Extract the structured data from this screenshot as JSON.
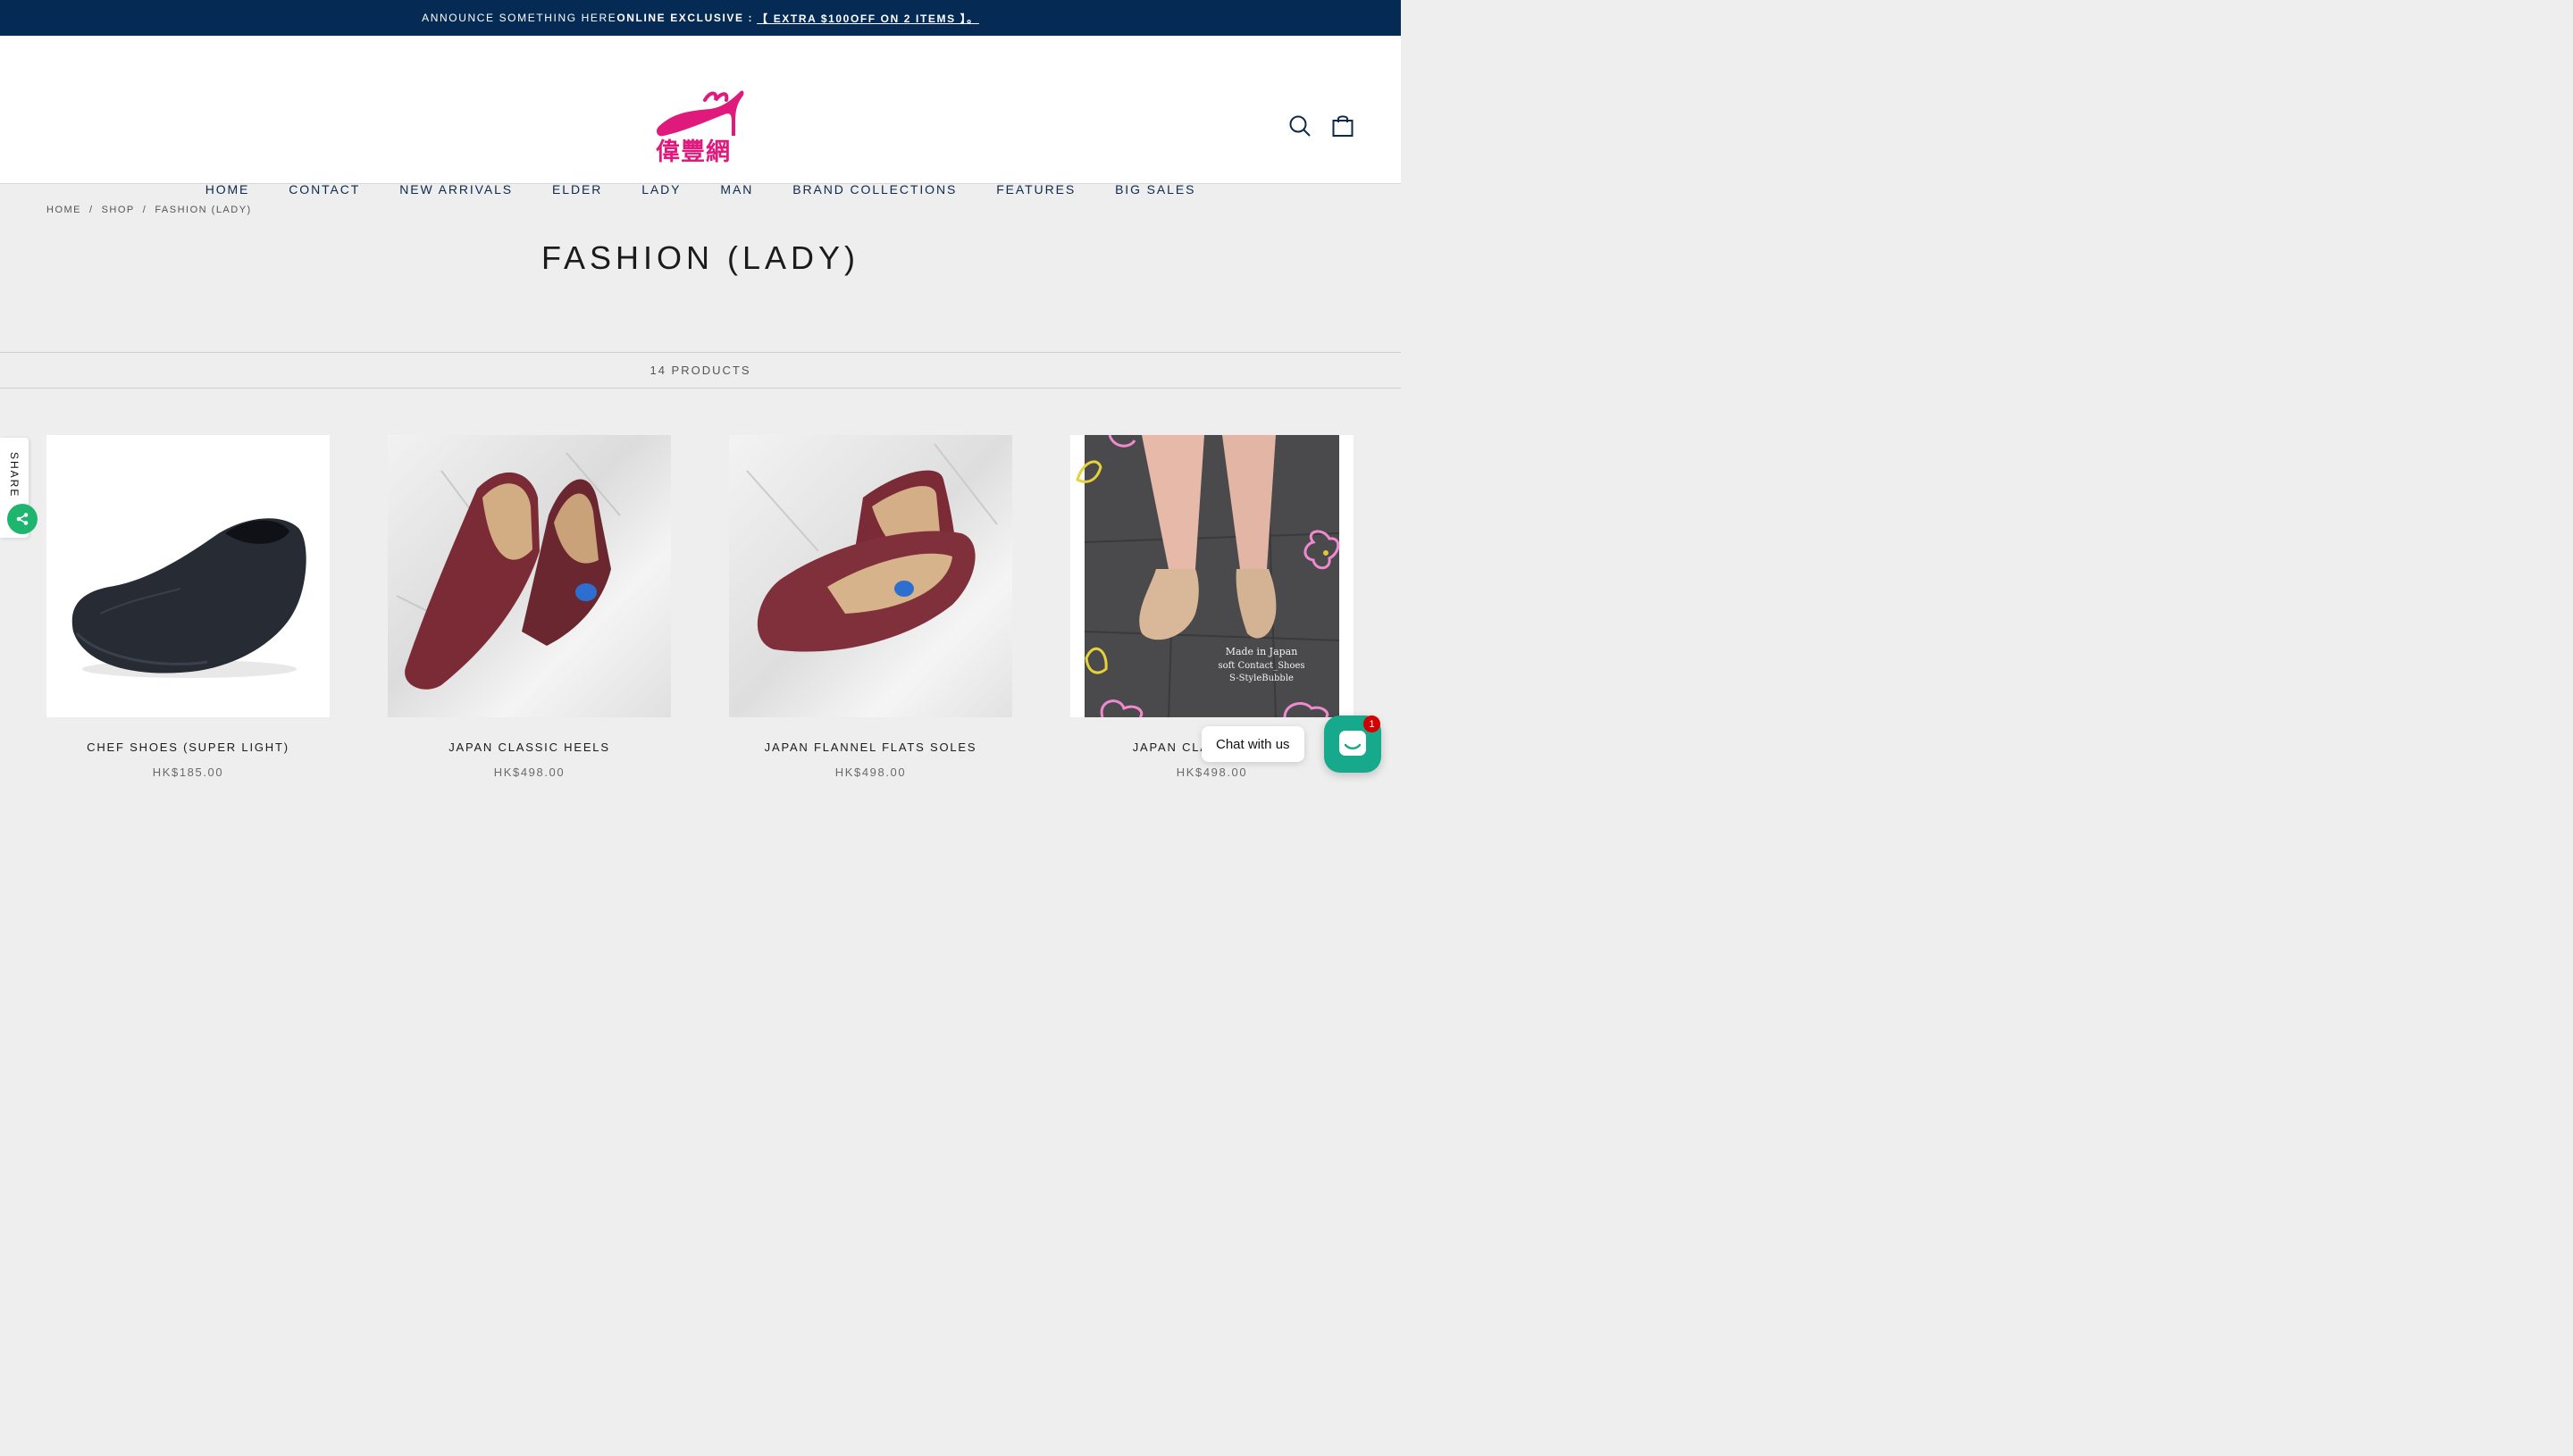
{
  "announcement": {
    "text": "ANNOUNCE SOMETHING HERE",
    "exclusive": "ONLINE EXCLUSIVE :",
    "offer": "【 EXTRA $100OFF ON 2 ITEMS 】。"
  },
  "logo": {
    "text": "偉豐網"
  },
  "nav": {
    "items": [
      "HOME",
      "CONTACT",
      "NEW ARRIVALS",
      "ELDER",
      "LADY",
      "MAN",
      "BRAND COLLECTIONS",
      "FEATURES",
      "BIG SALES"
    ]
  },
  "breadcrumb": {
    "items": [
      "HOME",
      "SHOP",
      "FASHION (LADY)"
    ],
    "separator": "/"
  },
  "page": {
    "title": "FASHION (LADY)",
    "count": "14 PRODUCTS"
  },
  "products": [
    {
      "name": "CHEF SHOES (SUPER LIGHT)",
      "price": "HK$185.00"
    },
    {
      "name": "JAPAN CLASSIC HEELS",
      "price": "HK$498.00"
    },
    {
      "name": "JAPAN FLANNEL FLATS SOLES",
      "price": "HK$498.00"
    },
    {
      "name": "JAPAN CLASSIC FLATS",
      "price": "HK$498.00",
      "overlay_lines": [
        "Made in Japan",
        "soft Contact_Shoes",
        "S-StyleBubble"
      ]
    }
  ],
  "share": {
    "label": "SHARE"
  },
  "chat": {
    "label": "Chat with us",
    "badge": "1"
  },
  "colors": {
    "announce_bg": "#052a53",
    "nav_text": "#0d2a4d",
    "brand_pink": "#e0197d",
    "chat_green": "#17a98b",
    "share_green": "#1fb56f"
  }
}
